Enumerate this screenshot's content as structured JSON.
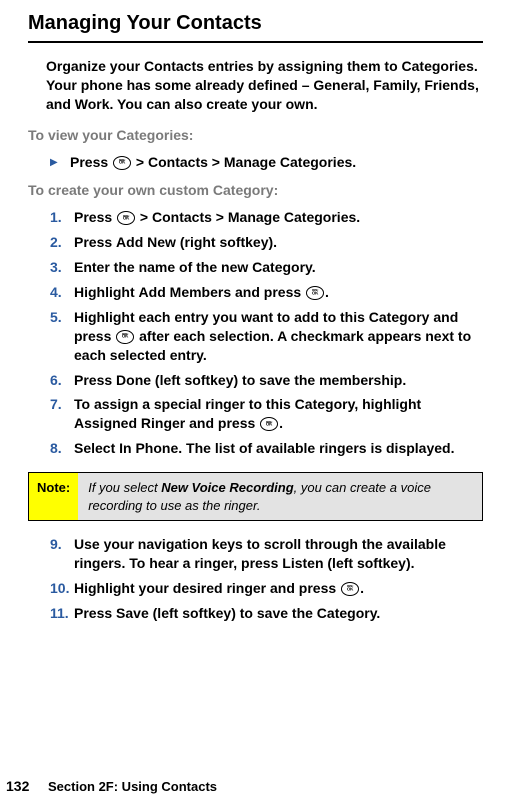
{
  "title": "Managing Your Contacts",
  "intro": "Organize your Contacts entries by assigning them to Categories. Your phone has some already defined – General, Family, Friends, and Work. You can also create your own.",
  "view_heading": "To view your Categories:",
  "view_step": {
    "press": "Press ",
    "after": " > ",
    "contacts": "Contacts",
    "sep2": " > ",
    "manage": "Manage Categories",
    "period": "."
  },
  "create_heading": "To create your own custom Category:",
  "steps": {
    "s1_press": "Press ",
    "s1_after": " > ",
    "s1_contacts": "Contacts",
    "s1_sep": " > ",
    "s1_manage": "Manage Categories",
    "s1_end": ".",
    "s2_a": "Press ",
    "s2_b": "Add New",
    "s2_c": " (right softkey).",
    "s3": "Enter the name of the new Category.",
    "s4_a": "Highlight ",
    "s4_b": "Add Members",
    "s4_c": " and press ",
    "s4_d": ".",
    "s5_a": "Highlight each entry you want to add to this Category and press ",
    "s5_b": " after each selection. A checkmark appears next to each selected entry.",
    "s6_a": "Press ",
    "s6_b": "Done",
    "s6_c": " (left softkey) to save the membership.",
    "s7_a": "To assign a special ringer to this Category, highlight ",
    "s7_b": "Assigned Ringer",
    "s7_c": " and press ",
    "s7_d": ".",
    "s8_a": "Select ",
    "s8_b": "In Phone",
    "s8_c": ". The list of available ringers is displayed.",
    "s9_a": "Use your navigation keys to scroll through the available ringers. To hear a ringer, press ",
    "s9_b": "Listen",
    "s9_c": " (left softkey).",
    "s10_a": "Highlight your desired ringer and press ",
    "s10_b": ".",
    "s11_a": "Press ",
    "s11_b": "Save",
    "s11_c": " (left softkey) to save the Category."
  },
  "step_numbers": {
    "n1": "1.",
    "n2": "2.",
    "n3": "3.",
    "n4": "4.",
    "n5": "5.",
    "n6": "6.",
    "n7": "7.",
    "n8": "8.",
    "n9": "9.",
    "n10": "10.",
    "n11": "11."
  },
  "note": {
    "label": "Note:",
    "a": "If you select ",
    "b": "New Voice Recording",
    "c": ", you can create a voice recording to use as the ringer."
  },
  "footer": {
    "page": "132",
    "section": "Section 2F: Using Contacts"
  }
}
